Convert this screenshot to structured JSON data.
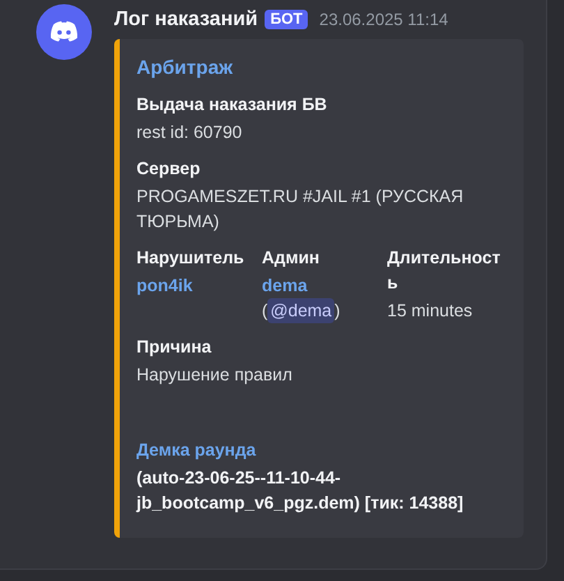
{
  "message": {
    "author": "Лог наказаний",
    "badge": "БОТ",
    "timestamp": "23.06.2025 11:14"
  },
  "embed": {
    "color": "#f0a30a",
    "title": "Арбитраж",
    "fields": [
      {
        "name": "Выдача наказания БВ",
        "kind": "text",
        "inline": false,
        "parts": [
          {
            "kind": "text",
            "text": "rest id: 60790"
          }
        ]
      },
      {
        "name": "Сервер",
        "kind": "text",
        "inline": false,
        "parts": [
          {
            "kind": "text",
            "text": "PROGAMESZET.RU #JAIL #1 (РУССКАЯ ТЮРЬМА)"
          }
        ]
      },
      {
        "name": "Нарушитель",
        "kind": "text",
        "inline": true,
        "parts": [
          {
            "kind": "link",
            "text": "pon4ik"
          }
        ]
      },
      {
        "name": "Админ",
        "kind": "text",
        "inline": true,
        "parts": [
          {
            "kind": "link",
            "text": "dema"
          },
          {
            "kind": "break"
          },
          {
            "kind": "text",
            "text": "("
          },
          {
            "kind": "mention",
            "text": "@dema"
          },
          {
            "kind": "text",
            "text": ")"
          }
        ]
      },
      {
        "name": "Длительность",
        "kind": "text",
        "inline": true,
        "parts": [
          {
            "kind": "text",
            "text": "15 minutes"
          }
        ]
      },
      {
        "name": "Причина",
        "kind": "text",
        "inline": false,
        "parts": [
          {
            "kind": "text",
            "text": "Нарушение правил"
          }
        ]
      },
      {
        "name": "Демка раунда",
        "kind": "link",
        "inline": false,
        "parts": [
          {
            "kind": "bold",
            "text": "(auto-23-06-25--11-10-44-jb_bootcamp_v6_pgz.dem) [тик: 14388]"
          }
        ]
      }
    ]
  }
}
